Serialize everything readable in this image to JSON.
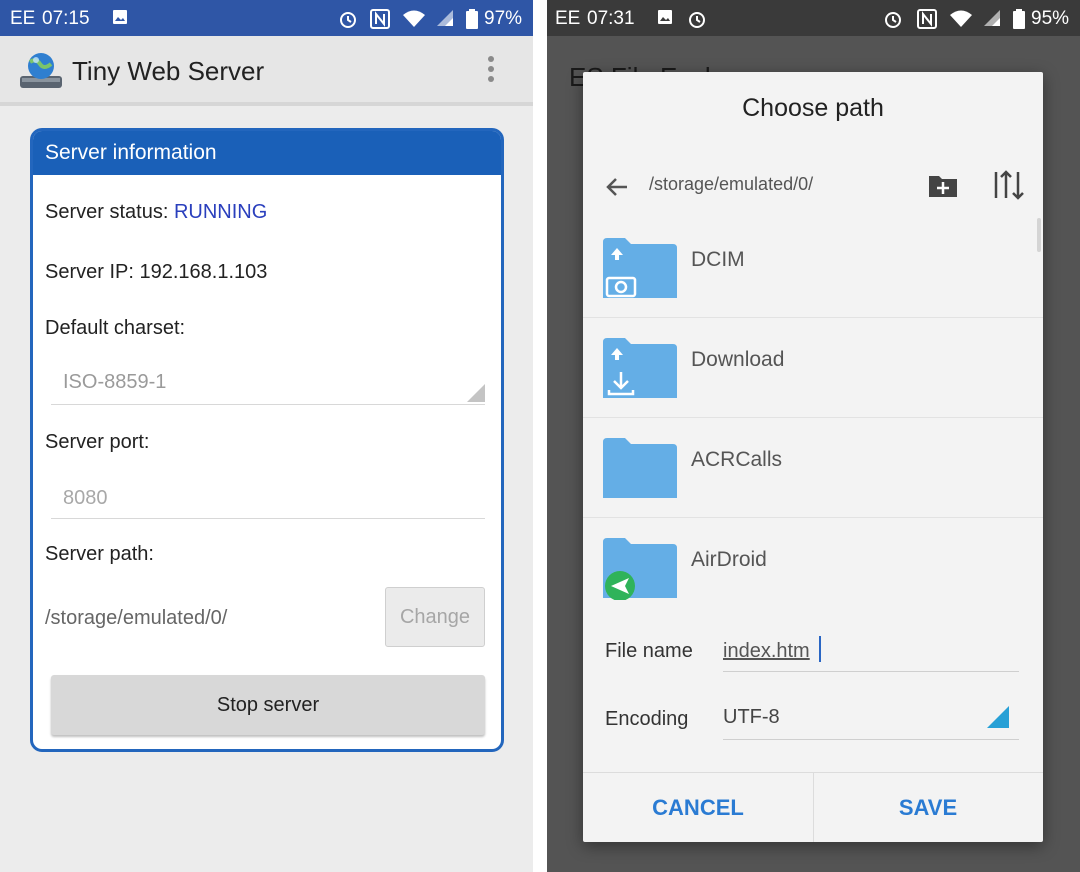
{
  "left": {
    "status_bar": {
      "carrier": "EE",
      "time": "07:15",
      "battery": "97%"
    },
    "app_title": "Tiny Web Server",
    "card_title": "Server information",
    "status_label": "Server status: ",
    "status_value": "RUNNING",
    "ip_text": "Server IP: 192.168.1.103",
    "charset_label": "Default charset:",
    "charset_value": "ISO-8859-1",
    "port_label": "Server port:",
    "port_value": "8080",
    "path_label": "Server path:",
    "path_value": "/storage/emulated/0/",
    "change_button": "Change",
    "stop_button": "Stop server"
  },
  "right": {
    "status_bar": {
      "carrier": "EE",
      "time": "07:31",
      "battery": "95%"
    },
    "background_title": "ES File Expl",
    "dialog_title": "Choose path",
    "current_path": "/storage/emulated/0/",
    "folders": [
      {
        "name": "DCIM",
        "icon": "camera-folder-icon"
      },
      {
        "name": "Download",
        "icon": "download-folder-icon"
      },
      {
        "name": "ACRCalls",
        "icon": "folder-icon"
      },
      {
        "name": "AirDroid",
        "icon": "airdroid-folder-icon"
      }
    ],
    "file_name_label": "File name",
    "file_name_value": "index.htm",
    "encoding_label": "Encoding",
    "encoding_value": "UTF-8",
    "cancel_button": "CANCEL",
    "save_button": "SAVE"
  },
  "colors": {
    "left_status_bar": "#2f56a6",
    "card_header": "#1a60b8",
    "running_text": "#2a3fbd",
    "folder": "#64aee6",
    "dialog_action": "#2a7bd3",
    "encoding_triangle": "#27a0d6"
  }
}
